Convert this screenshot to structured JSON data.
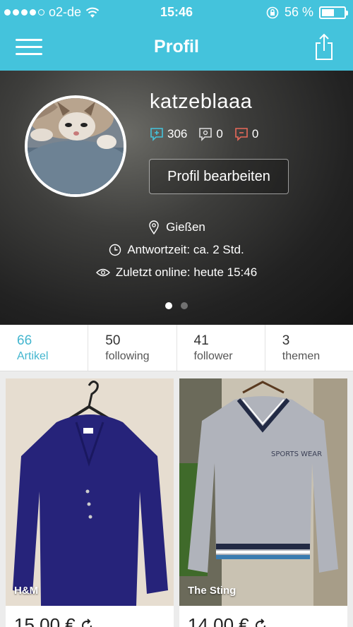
{
  "status_bar": {
    "carrier": "o2-de",
    "time": "15:46",
    "battery": "56 %",
    "battery_level": 0.56
  },
  "nav": {
    "title": "Profil"
  },
  "profile": {
    "username": "katzeblaaa",
    "counts": {
      "positive": "306",
      "neutral": "0",
      "negative": "0"
    },
    "edit_label": "Profil bearbeiten",
    "location": "Gießen",
    "response_time": "Antwortzeit: ca. 2 Std.",
    "last_online": "Zuletzt online: heute 15:46"
  },
  "stats": [
    {
      "num": "66",
      "label": "Artikel"
    },
    {
      "num": "50",
      "label": "following"
    },
    {
      "num": "41",
      "label": "follower"
    },
    {
      "num": "3",
      "label": "themen"
    }
  ],
  "items": [
    {
      "brand": "H&M",
      "price": "15,00 €"
    },
    {
      "brand": "The Sting",
      "price": "14,00 €"
    }
  ],
  "colors": {
    "accent": "#44c3dc",
    "active_tab": "#44b6cf"
  }
}
